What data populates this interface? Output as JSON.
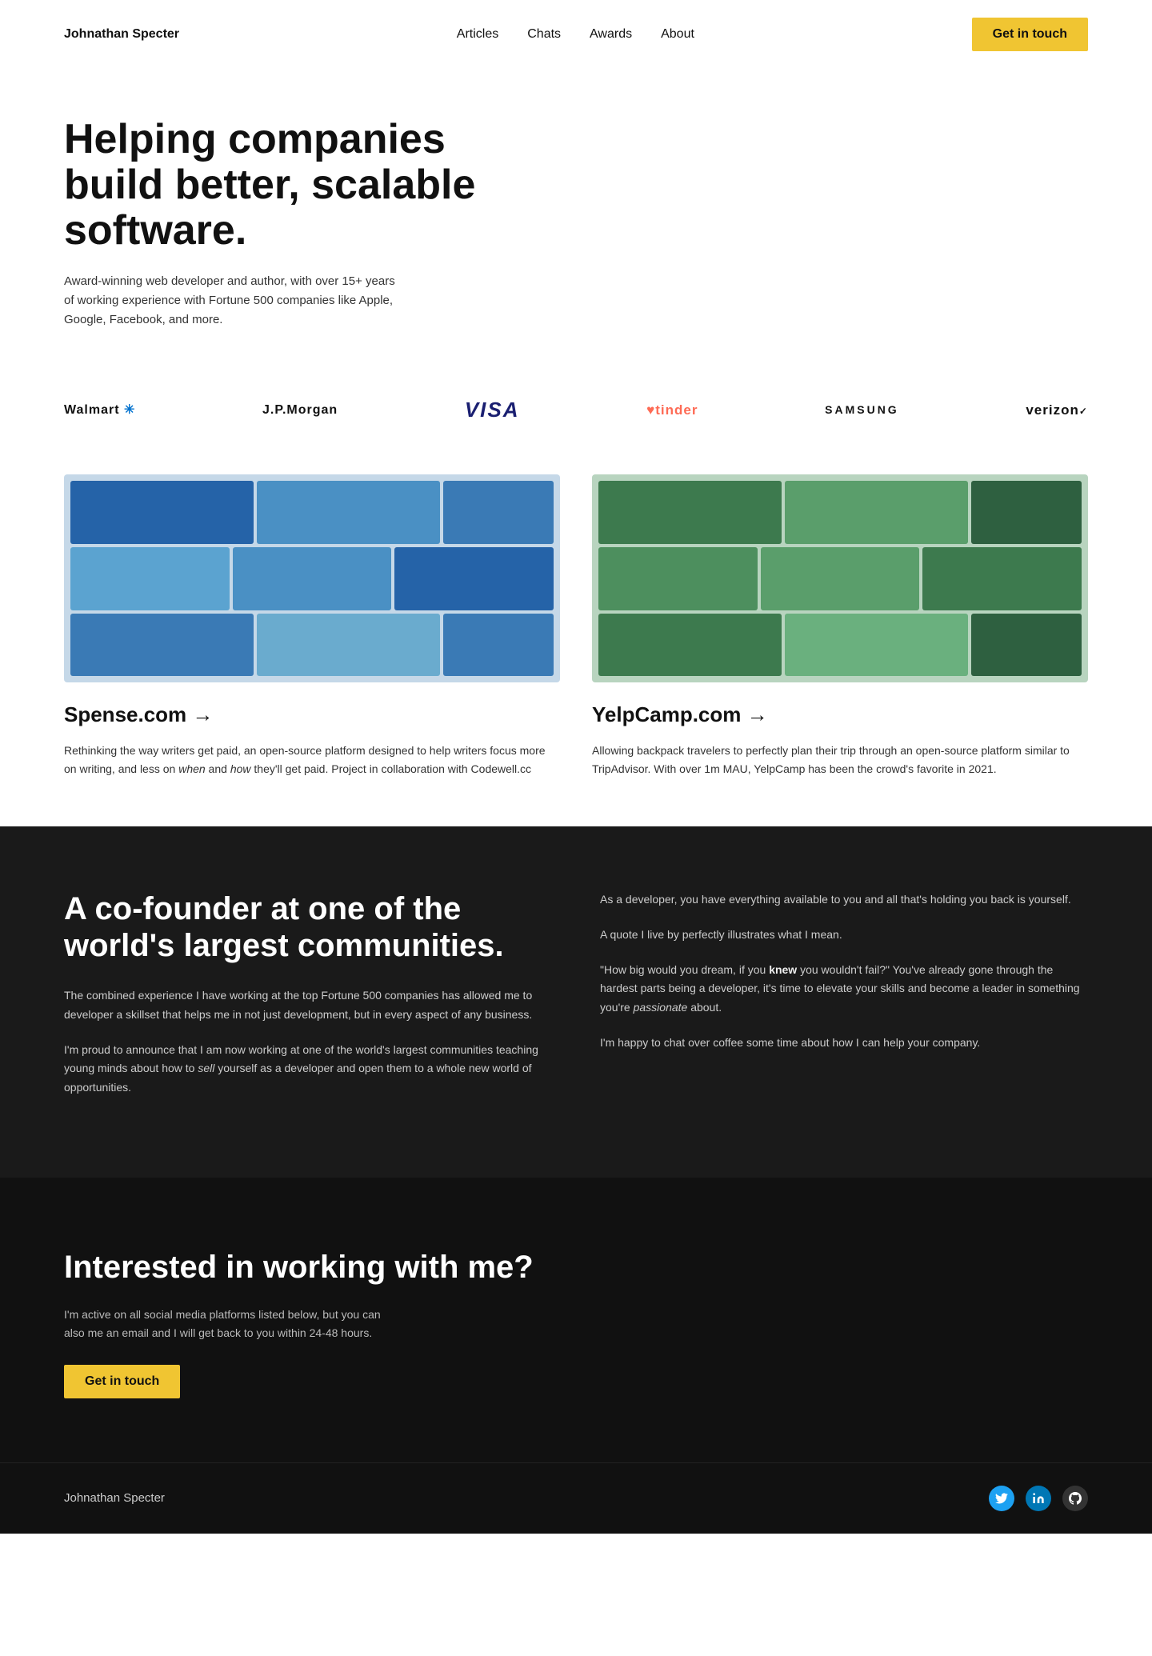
{
  "nav": {
    "logo": "Johnathan Specter",
    "links": [
      "Articles",
      "Chats",
      "Awards",
      "About"
    ],
    "cta": "Get in touch"
  },
  "hero": {
    "heading": "Helping companies build better, scalable software.",
    "subtext": "Award-winning web developer and author, with over 15+ years of working experience with Fortune 500 companies like Apple, Google, Facebook, and more."
  },
  "logos": [
    {
      "name": "Walmart",
      "display": "Walmart ✳",
      "class": "logo-walmart"
    },
    {
      "name": "JPMorgan",
      "display": "J.P.Morgan",
      "class": "logo-jpmorgan"
    },
    {
      "name": "Visa",
      "display": "VISA",
      "class": "logo-visa"
    },
    {
      "name": "Tinder",
      "display": "tinder",
      "class": "logo-tinder"
    },
    {
      "name": "Samsung",
      "display": "SAMSUNG",
      "class": "logo-samsung"
    },
    {
      "name": "Verizon",
      "display": "verizon✓",
      "class": "logo-verizon"
    }
  ],
  "projects": [
    {
      "title": "Spense.com →",
      "desc": "Rethinking the way writers get paid, an open-source platform designed to help writers focus more on writing, and less on when and how they'll get paid. Project in collaboration with Codewell.cc"
    },
    {
      "title": "YelpCamp.com →",
      "desc": "Allowing backpack travelers to perfectly plan their trip through an open-source platform similar to TripAdvisor. With over 1m MAU, YelpCamp has been the crowd's favorite in 2021."
    }
  ],
  "about": {
    "heading": "A co-founder at one of the world's largest communities.",
    "left_p1": "The combined experience I have working at the top Fortune 500 companies has allowed me to developer a skillset that helps me in not just development, but in every aspect of any business.",
    "left_p2": "I'm proud to announce that I am now working at one of the world's largest communities teaching young minds about how to sell yourself as a developer and open them to a whole new world of opportunities.",
    "right_p1": "As a developer, you have everything available to you and all that's holding you back is yourself.",
    "right_p2": "A quote I live by perfectly illustrates what I mean.",
    "right_quote": "\"How big would you dream, if you knew you wouldn't fail?\" You've already gone through the hardest parts being a developer, it's time to elevate your skills and become a leader in something you're passionate about.",
    "right_p3": "I'm happy to chat over coffee some time about how I can help your company."
  },
  "contact": {
    "heading": "Interested in working with me?",
    "desc": "I'm active on all social media platforms listed below, but you can also me an email and I will get back to you within 24-48 hours.",
    "cta": "Get in touch"
  },
  "footer": {
    "logo": "Johnathan Specter",
    "social": [
      "Twitter",
      "LinkedIn",
      "GitHub"
    ]
  }
}
